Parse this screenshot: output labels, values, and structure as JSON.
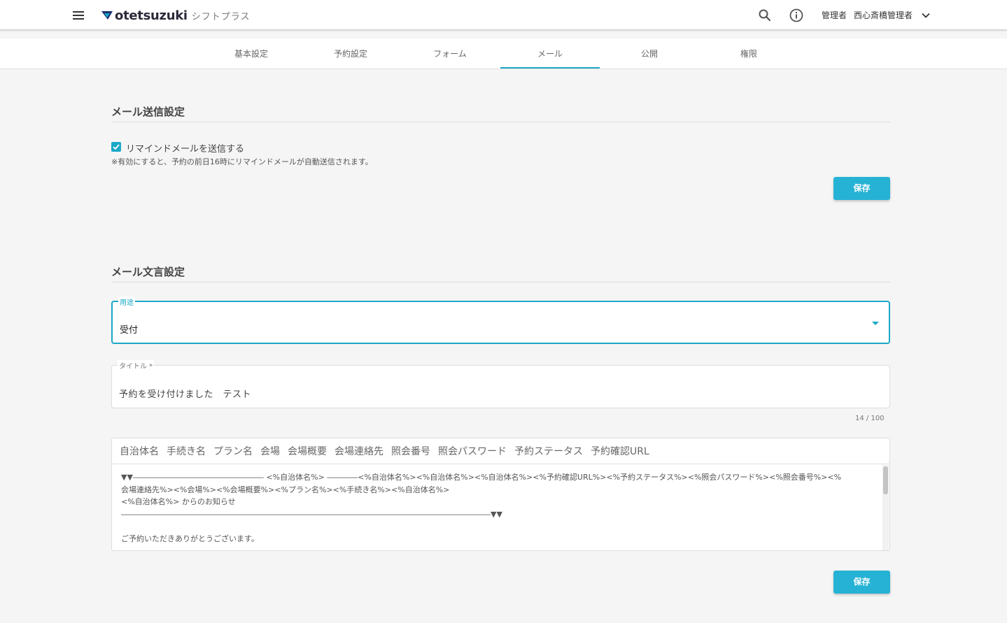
{
  "header": {
    "brand": "otetsuzuki",
    "brand_sub": "シフトプラス",
    "user_role": "管理者",
    "user_name": "西心斎橋管理者"
  },
  "tabs": [
    {
      "label": "基本設定",
      "active": false
    },
    {
      "label": "予約設定",
      "active": false
    },
    {
      "label": "フォーム",
      "active": false
    },
    {
      "label": "メール",
      "active": true
    },
    {
      "label": "公開",
      "active": false
    },
    {
      "label": "権限",
      "active": false
    }
  ],
  "send_section": {
    "title": "メール送信設定",
    "checkbox_label": "リマインドメールを送信する",
    "checkbox_checked": true,
    "note": "※有効にすると、予約の前日16時にリマインドメールが自動送信されます。",
    "save_label": "保存"
  },
  "text_section": {
    "title": "メール文言設定",
    "use_label": "用途",
    "use_value": "受付",
    "title_label": "タイトル *",
    "title_value": "予約を受け付けました　テスト",
    "title_counter": "14 / 100",
    "insert_items": [
      "自治体名",
      "手続き名",
      "プラン名",
      "会場",
      "会場概要",
      "会場連絡先",
      "照会番号",
      "照会パスワード",
      "予約ステータス",
      "予約確認URL"
    ],
    "body_lines": [
      "▼▼――――――――――――――――― <%自治体名%> ――――<%自治体名%><%自治体名%><%自治体名%><%予約確認URL%><%予約ステータス%><%照会パスワード%><%照会番号%><%",
      "会場連絡先%><%会場%><%会場概要%><%プラン名%><%手続き名%><%自治体名%>",
      "<%自治体名%> からのお知らせ",
      "――――――――――――――――――――――――――――――――――――――――――――――――▼▼",
      "",
      "ご予約いただきありがとうございます。"
    ],
    "save_label": "保存"
  },
  "colors": {
    "accent": "#1ba8c8",
    "button": "#26b2d4",
    "background": "#f5f5f5"
  },
  "icons": [
    "menu-icon",
    "logo-mark-icon",
    "search-icon",
    "info-icon",
    "chevron-down-icon",
    "dropdown-caret-icon",
    "check-icon"
  ]
}
